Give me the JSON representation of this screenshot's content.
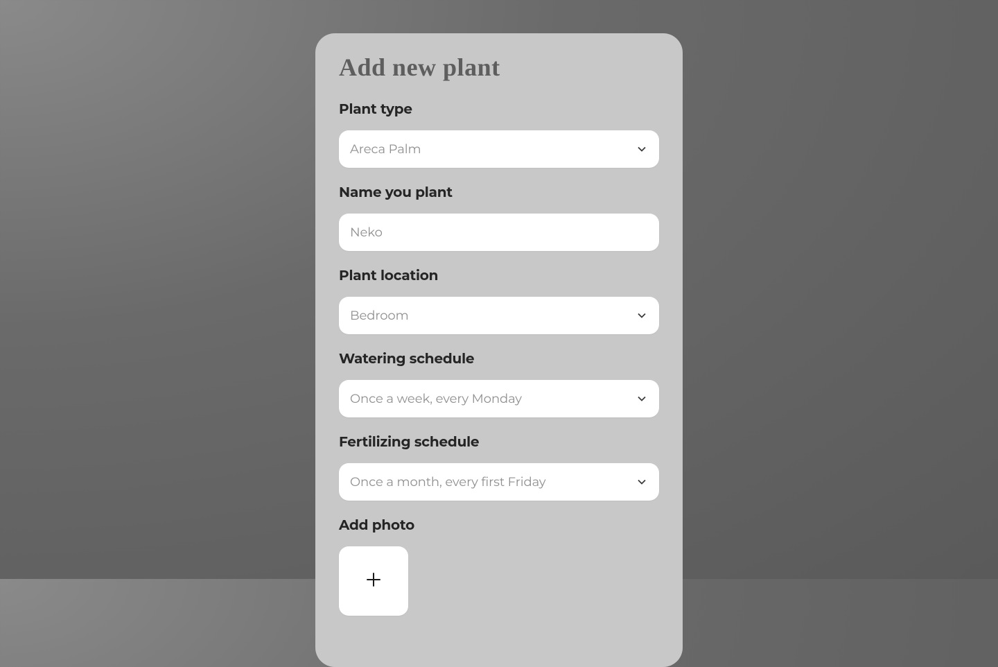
{
  "modal": {
    "title": "Add new plant",
    "fields": {
      "plantType": {
        "label": "Plant type",
        "value": "Areca Palm"
      },
      "plantName": {
        "label": "Name you plant",
        "value": "Neko"
      },
      "plantLocation": {
        "label": "Plant location",
        "value": "Bedroom"
      },
      "wateringSchedule": {
        "label": "Watering schedule",
        "value": "Once a week, every Monday"
      },
      "fertilizingSchedule": {
        "label": "Fertilizing schedule",
        "value": "Once a month, every first Friday"
      },
      "addPhoto": {
        "label": "Add photo"
      }
    }
  }
}
